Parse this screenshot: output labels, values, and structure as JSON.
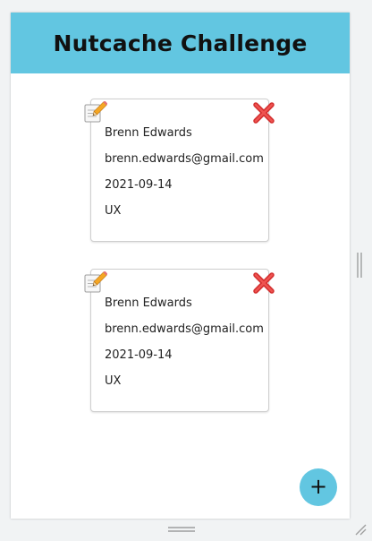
{
  "app": {
    "title": "Nutcache Challenge",
    "colors": {
      "header_bg": "#62c6e1",
      "fab_bg": "#62c6e1",
      "card_border": "#cfcfcf"
    }
  },
  "cards": [
    {
      "name": "Brenn Edwards",
      "email": "brenn.edwards@gmail.com",
      "date": "2021-09-14",
      "role": "UX",
      "edit_icon": "pencil-memo-icon",
      "delete_icon": "red-cross-icon"
    },
    {
      "name": "Brenn Edwards",
      "email": "brenn.edwards@gmail.com",
      "date": "2021-09-14",
      "role": "UX",
      "edit_icon": "pencil-memo-icon",
      "delete_icon": "red-cross-icon"
    }
  ],
  "fab": {
    "label": "+",
    "icon": "plus-icon"
  }
}
